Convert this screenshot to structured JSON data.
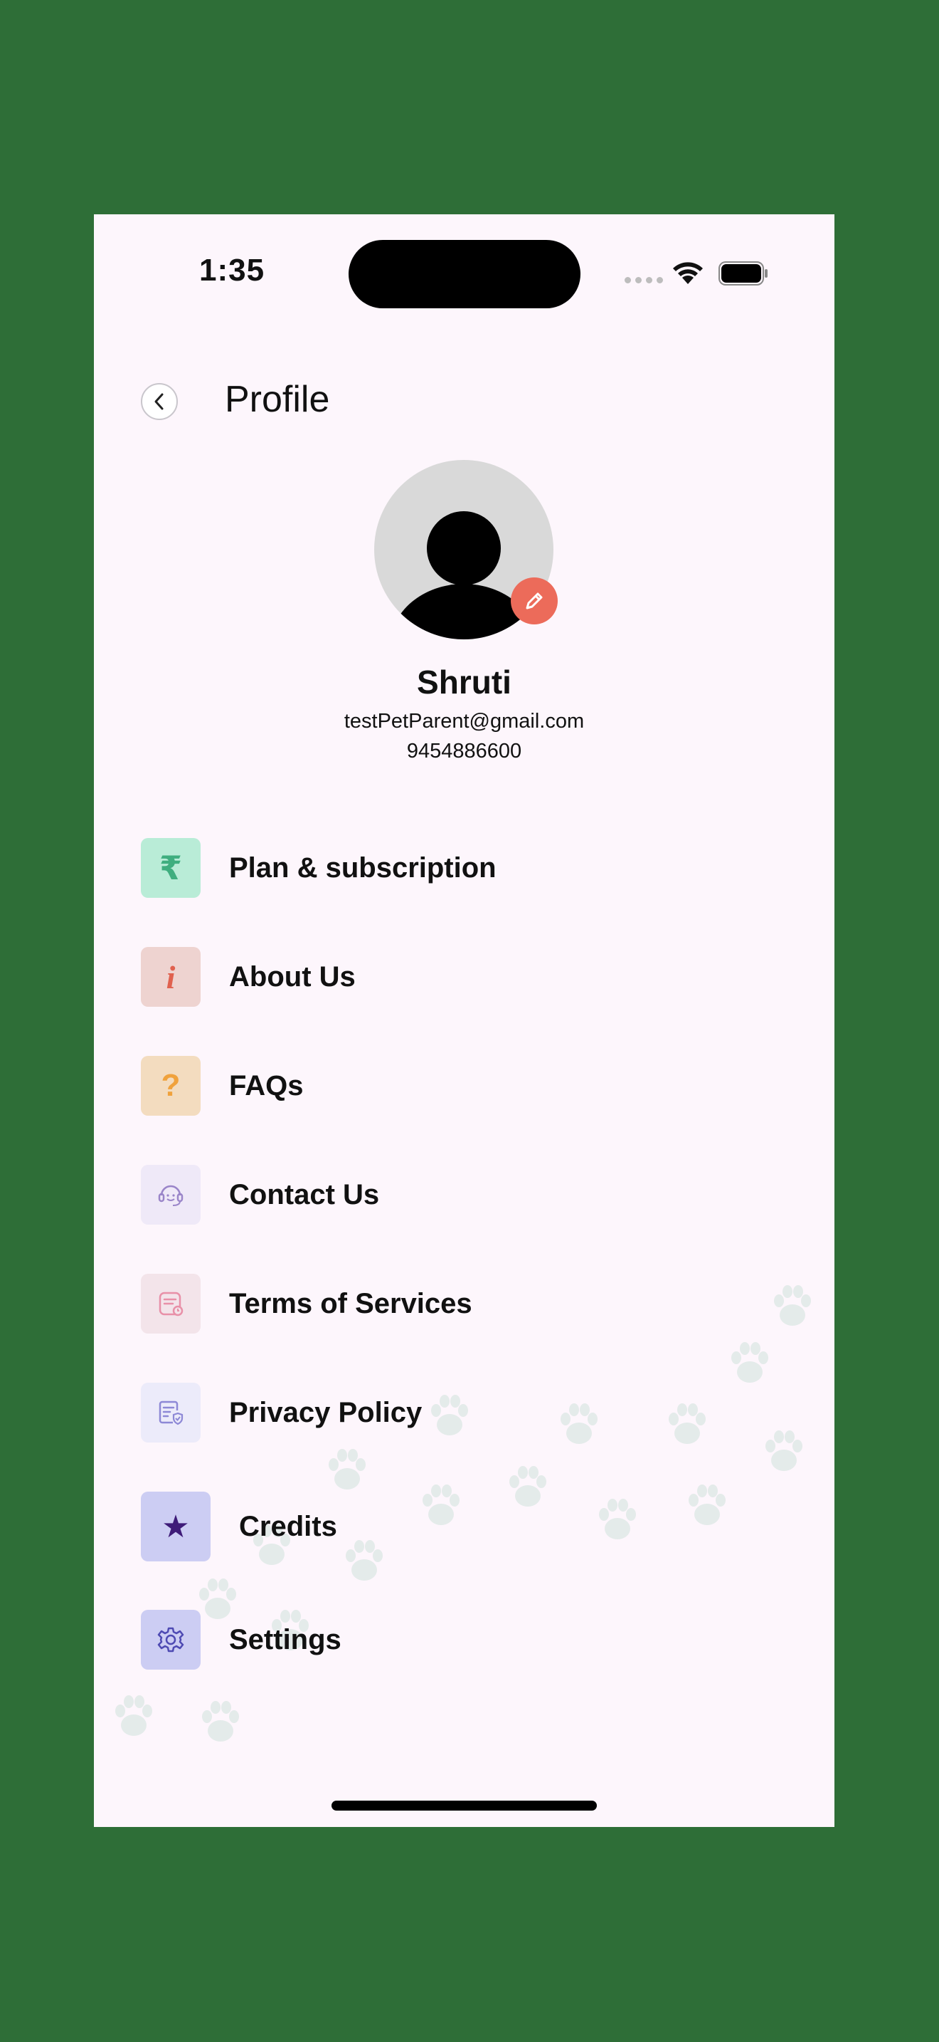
{
  "status_bar": {
    "time": "1:35"
  },
  "header": {
    "title": "Profile",
    "back_icon": "chevron-left-icon"
  },
  "profile": {
    "name": "Shruti",
    "email": "testPetParent@gmail.com",
    "phone": "9454886600",
    "edit_icon": "pencil-icon"
  },
  "menu": [
    {
      "label": "Plan & subscription",
      "icon": "rupee-icon",
      "icon_glyph": "₹",
      "icon_bg": "#b9ecd7",
      "icon_color": "#3fae7f"
    },
    {
      "label": "About Us",
      "icon": "info-icon",
      "icon_glyph": "i",
      "icon_bg": "#eed3d0",
      "icon_color": "#e0614f"
    },
    {
      "label": "FAQs",
      "icon": "question-icon",
      "icon_glyph": "?",
      "icon_bg": "#f3dcbf",
      "icon_color": "#f0a23c"
    },
    {
      "label": "Contact Us",
      "icon": "headset-icon",
      "icon_glyph": "",
      "icon_bg": "#efe9f8",
      "icon_color": "#9a85c9"
    },
    {
      "label": "Terms of Services",
      "icon": "document-icon",
      "icon_glyph": "",
      "icon_bg": "#f3e4ea",
      "icon_color": "#e890a8"
    },
    {
      "label": "Privacy Policy",
      "icon": "shield-document-icon",
      "icon_glyph": "",
      "icon_bg": "#ecebfa",
      "icon_color": "#8d88d6"
    },
    {
      "label": "Credits",
      "icon": "star-icon",
      "icon_glyph": "★",
      "icon_bg": "#cccdf3",
      "icon_color": "#3e1b78"
    },
    {
      "label": "Settings",
      "icon": "gear-icon",
      "icon_glyph": "",
      "icon_bg": "#cccdf3",
      "icon_color": "#4e4ab3"
    }
  ],
  "colors": {
    "outer_background": "#2e6e37",
    "screen_background": "#fdf6fc",
    "edit_button": "#ec6b5a"
  }
}
